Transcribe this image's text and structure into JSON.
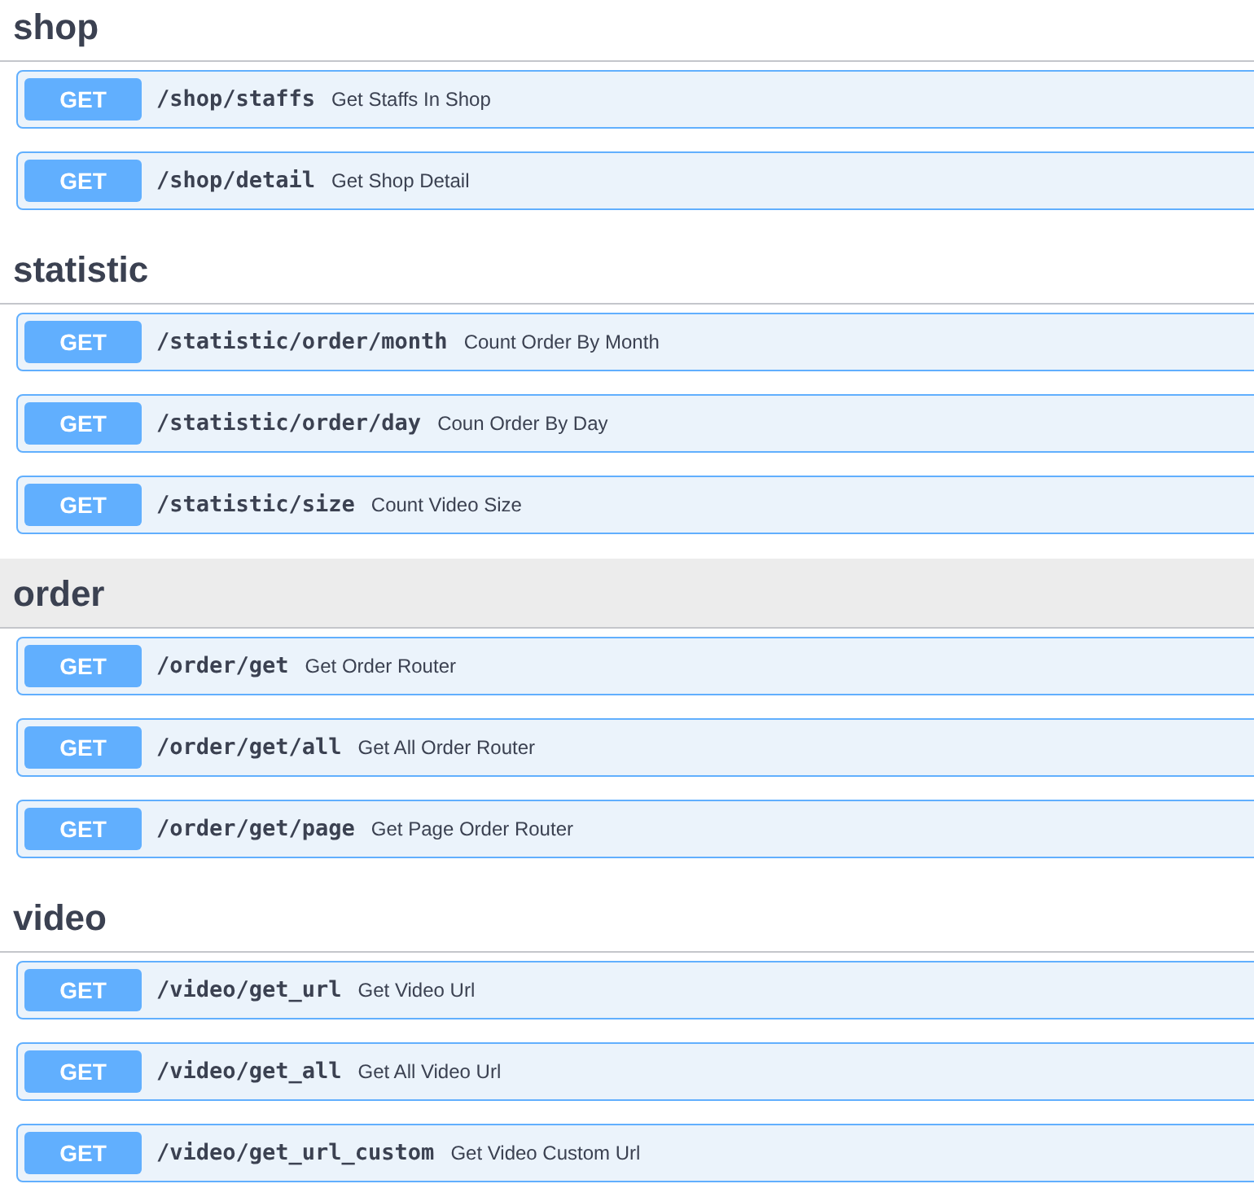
{
  "sections": [
    {
      "title": "shop",
      "hovered": false,
      "operations": [
        {
          "method": "GET",
          "path": "/shop/staffs",
          "summary": "Get Staffs In Shop"
        },
        {
          "method": "GET",
          "path": "/shop/detail",
          "summary": "Get Shop Detail"
        }
      ]
    },
    {
      "title": "statistic",
      "hovered": false,
      "operations": [
        {
          "method": "GET",
          "path": "/statistic/order/month",
          "summary": "Count Order By Month"
        },
        {
          "method": "GET",
          "path": "/statistic/order/day",
          "summary": "Coun Order By Day"
        },
        {
          "method": "GET",
          "path": "/statistic/size",
          "summary": "Count Video Size"
        }
      ]
    },
    {
      "title": "order",
      "hovered": true,
      "operations": [
        {
          "method": "GET",
          "path": "/order/get",
          "summary": "Get Order Router"
        },
        {
          "method": "GET",
          "path": "/order/get/all",
          "summary": "Get All Order Router"
        },
        {
          "method": "GET",
          "path": "/order/get/page",
          "summary": "Get Page Order Router"
        }
      ]
    },
    {
      "title": "video",
      "hovered": false,
      "operations": [
        {
          "method": "GET",
          "path": "/video/get_url",
          "summary": "Get Video Url"
        },
        {
          "method": "GET",
          "path": "/video/get_all",
          "summary": "Get All Video Url"
        },
        {
          "method": "GET",
          "path": "/video/get_url_custom",
          "summary": "Get Video Custom Url"
        }
      ]
    }
  ]
}
